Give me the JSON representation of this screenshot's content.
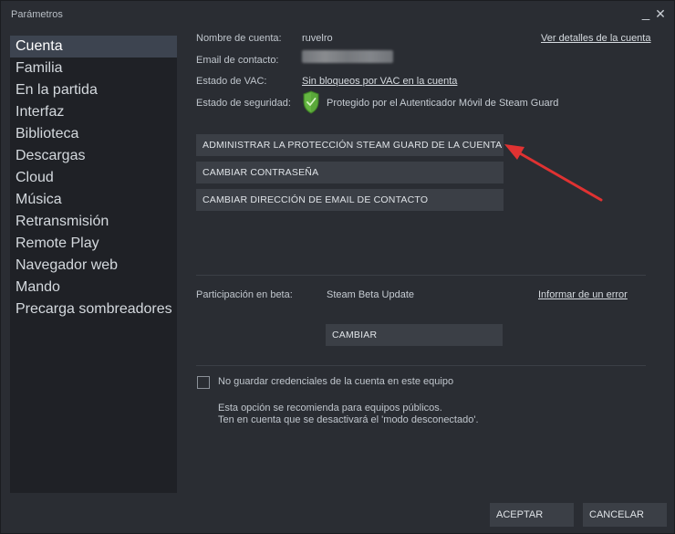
{
  "window": {
    "title": "Parámetros",
    "minimize_glyph": "_",
    "close_glyph": "✕"
  },
  "sidebar": {
    "items": [
      "Cuenta",
      "Familia",
      "En la partida",
      "Interfaz",
      "Biblioteca",
      "Descargas",
      "Cloud",
      "Música",
      "Retransmisión",
      "Remote Play",
      "Navegador web",
      "Mando",
      "Precarga sombreadores"
    ],
    "active_index": 0
  },
  "account": {
    "name_label": "Nombre de cuenta:",
    "name_value": "ruvelro",
    "details_link": "Ver detalles de la cuenta",
    "email_label": "Email de contacto:",
    "vac_label": "Estado de VAC:",
    "vac_value": "Sin bloqueos por VAC en la cuenta",
    "security_label": "Estado de seguridad:",
    "security_value": "Protegido por el Autenticador Móvil de Steam Guard",
    "shield_color": "#5aa83a"
  },
  "buttons": {
    "steam_guard": "ADMINISTRAR LA PROTECCIÓN STEAM GUARD DE LA CUENTA",
    "change_password": "CAMBIAR CONTRASEÑA",
    "change_email": "CAMBIAR DIRECCIÓN DE EMAIL DE CONTACTO"
  },
  "beta": {
    "label": "Participación en beta:",
    "value": "Steam Beta Update",
    "report_link": "Informar de un error",
    "change_button": "CAMBIAR"
  },
  "credentials": {
    "checkbox_label": "No guardar credenciales de la cuenta en este equipo",
    "checked": false,
    "note_line1": "Esta opción se recomienda para equipos públicos.",
    "note_line2": "Ten en cuenta que se desactivará el 'modo desconectado'."
  },
  "footer": {
    "accept": "ACEPTAR",
    "cancel": "CANCELAR"
  },
  "annotation": {
    "arrow_color": "#e03232",
    "arrow_icon": "red-arrow-icon"
  }
}
